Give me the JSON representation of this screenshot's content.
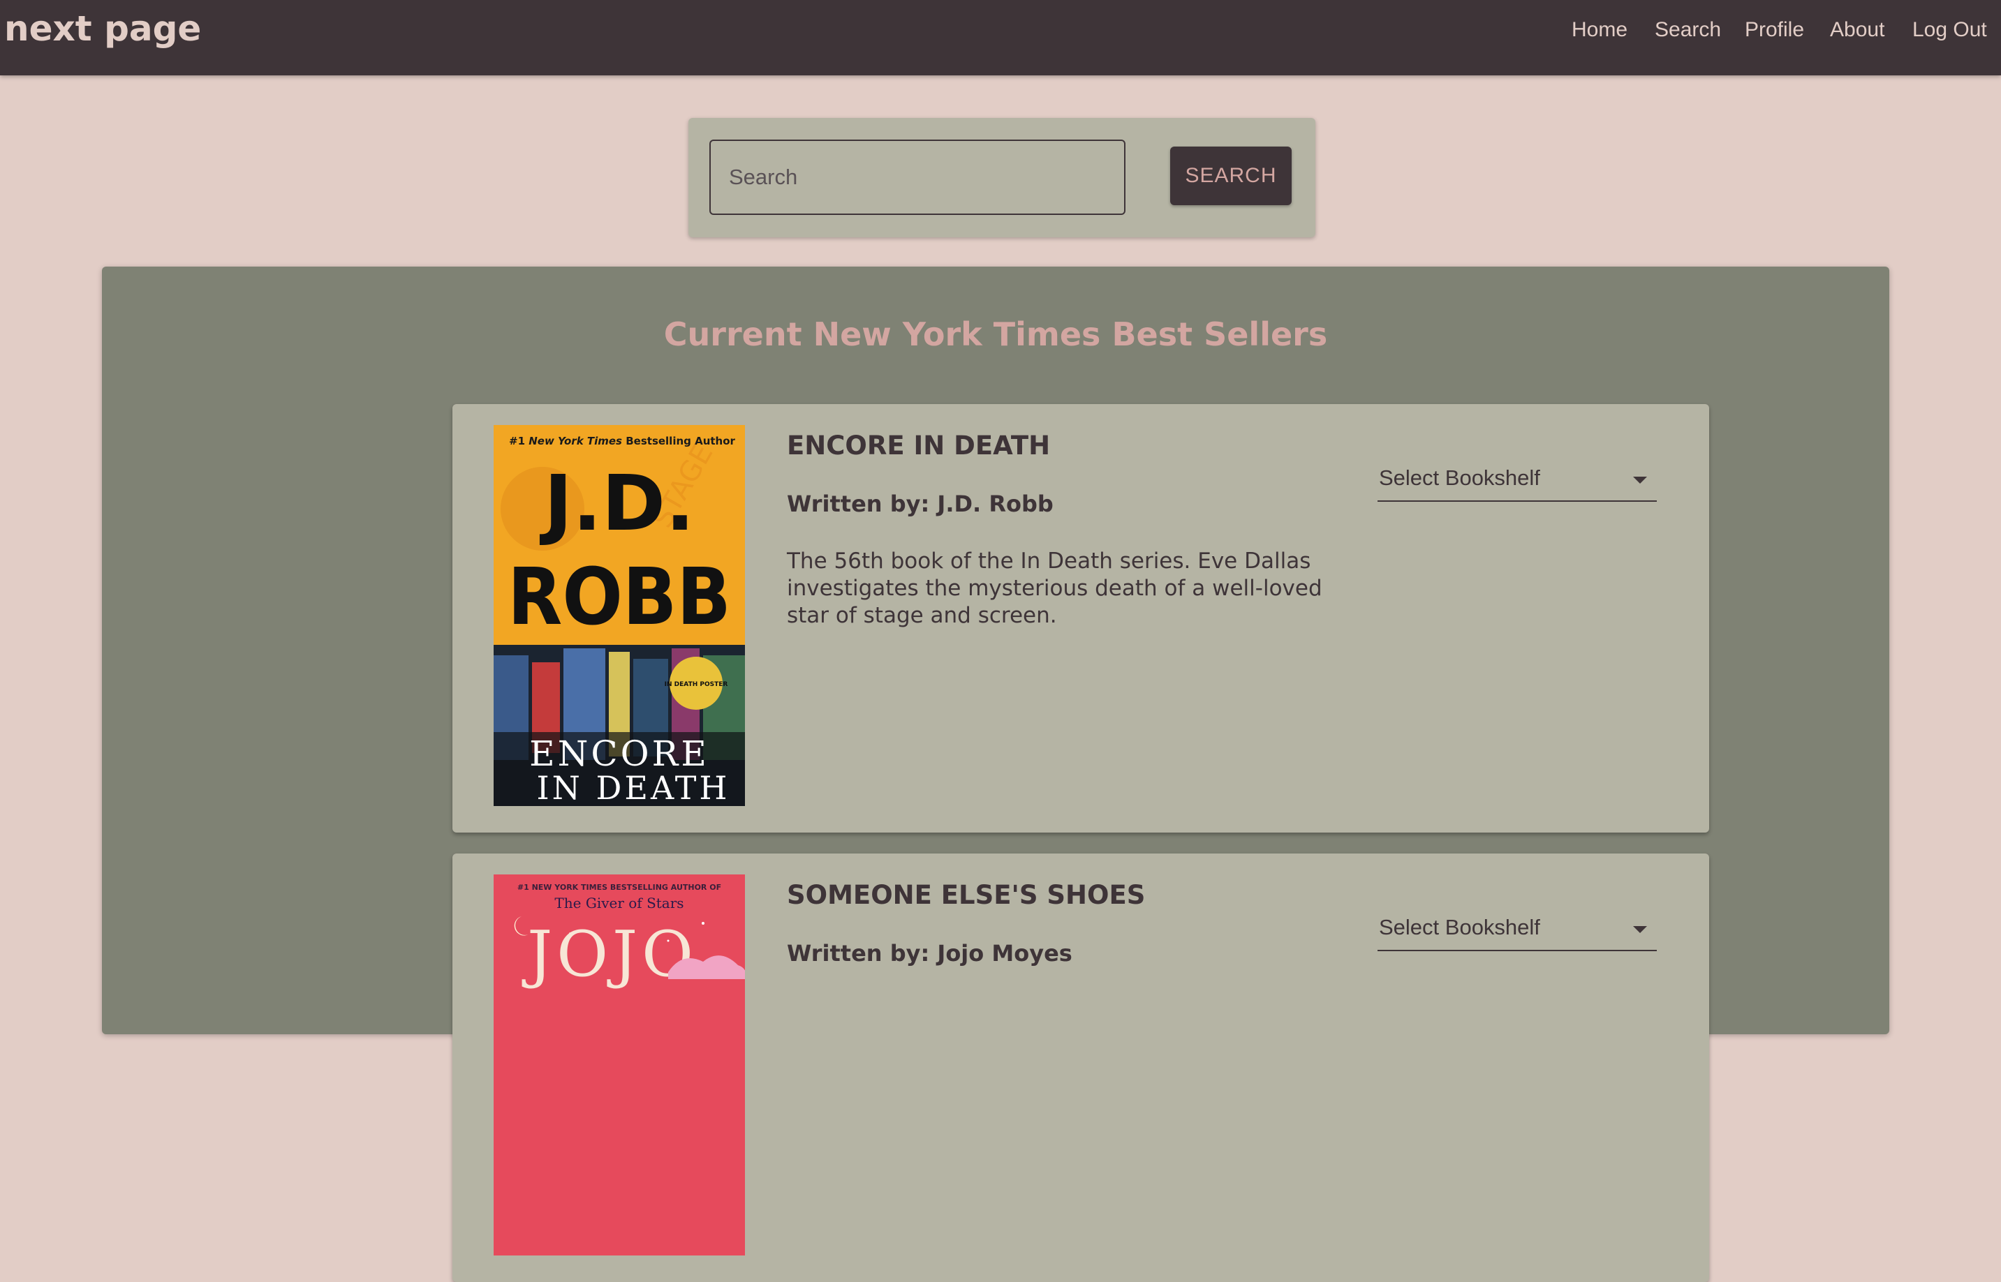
{
  "navbar": {
    "brand": "next page",
    "links": [
      {
        "label": "Home"
      },
      {
        "label": "Search"
      },
      {
        "label": "Profile"
      },
      {
        "label": "About"
      },
      {
        "label": "Log Out"
      }
    ]
  },
  "search": {
    "placeholder": "Search",
    "value": "",
    "button_label": "SEARCH"
  },
  "bestsellers": {
    "title": "Current New York Times Best Sellers",
    "books": [
      {
        "title": "ENCORE IN DEATH",
        "author_line": "Written by: J.D. Robb",
        "description": "The 56th book of the In Death series. Eve Dallas investigates the mysterious death of a well-loved star of stage and screen.",
        "bookshelf_label": "Select Bookshelf",
        "cover": {
          "tagline_prefix": "#1",
          "tagline_italic": "New York Times",
          "tagline_suffix": "Bestselling Author",
          "author_line1": "J.D.",
          "author_line2": "ROBB",
          "title_line1": "ENCORE",
          "title_line2": "IN DEATH",
          "sticker_text": "IN DEATH POSTER",
          "background_color": "#f2a623"
        }
      },
      {
        "title": "SOMEONE ELSE'S SHOES",
        "author_line": "Written by: Jojo Moyes",
        "description": "",
        "bookshelf_label": "Select Bookshelf",
        "cover": {
          "tagline": "#1 NEW YORK TIMES BESTSELLING AUTHOR OF",
          "subtitle": "The Giver of Stars",
          "author_name": "JOJO",
          "background_color": "#e64a5c"
        }
      }
    ]
  },
  "colors": {
    "navbar_bg": "#3e3438",
    "page_bg": "#e2cdc6",
    "panel_bg": "#7f8274",
    "card_bg": "#b5b4a4",
    "accent": "#d3a6a1"
  }
}
